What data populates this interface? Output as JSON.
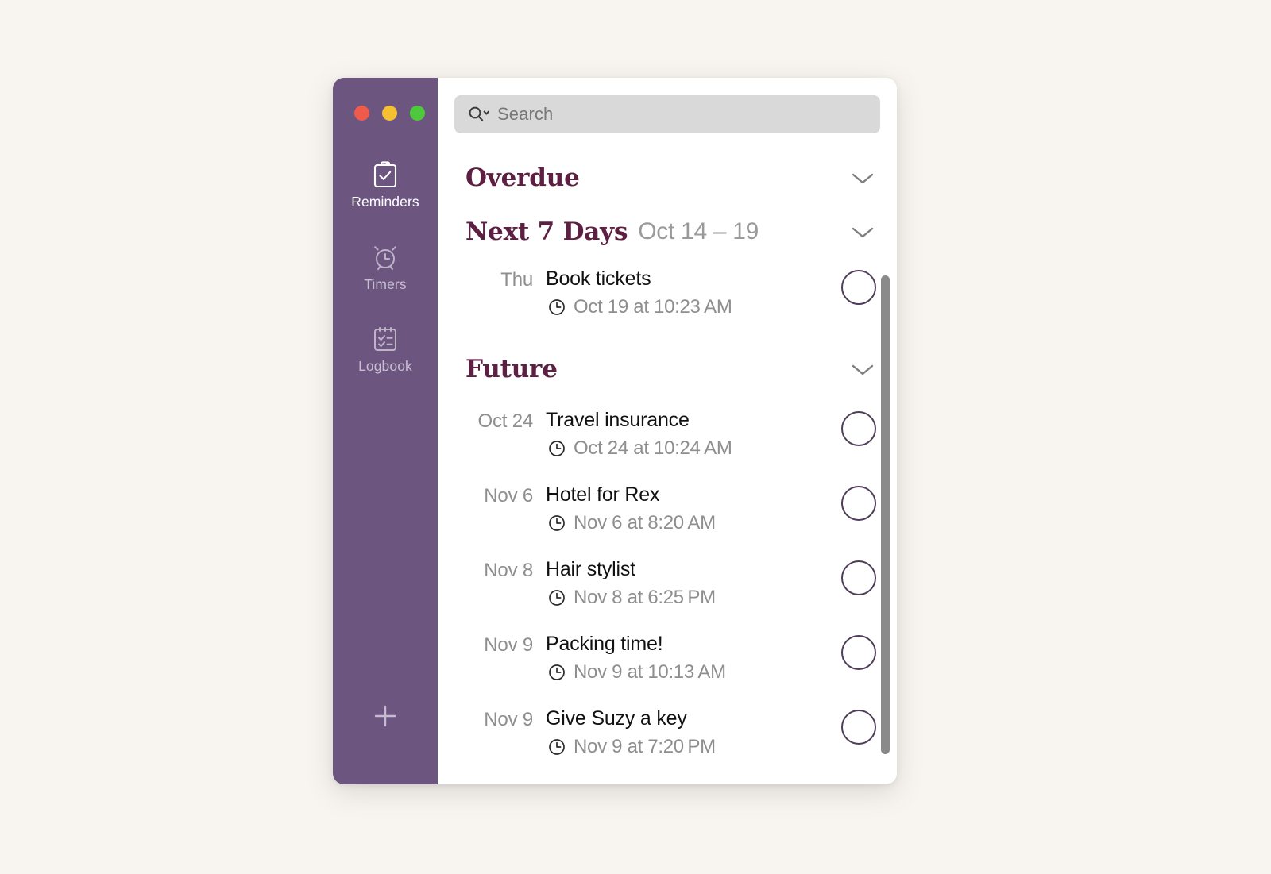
{
  "window": {
    "traffic_lights": [
      {
        "name": "close",
        "color": "#F05A4B"
      },
      {
        "name": "minimize",
        "color": "#F5C133"
      },
      {
        "name": "zoom",
        "color": "#4FC93C"
      }
    ]
  },
  "sidebar": {
    "background_color": "#6C5680",
    "items": [
      {
        "label": "Reminders",
        "icon": "clipboard-check-icon",
        "active": true
      },
      {
        "label": "Timers",
        "icon": "alarm-clock-icon",
        "active": false
      },
      {
        "label": "Logbook",
        "icon": "checklist-icon",
        "active": false
      }
    ],
    "add_button": {
      "icon": "plus-icon",
      "label": "+"
    }
  },
  "search": {
    "placeholder": "Search",
    "value": "",
    "icon": "search-magnifier-chevron-icon"
  },
  "sections": [
    {
      "title": "Overdue",
      "range": "",
      "collapse_icon": "chevron-down-icon",
      "tasks": []
    },
    {
      "title": "Next 7 Days",
      "range": "Oct 14 – 19",
      "collapse_icon": "chevron-down-icon",
      "tasks": [
        {
          "date": "Thu",
          "title": "Book tickets",
          "time": "Oct 19 at 10:23 AM",
          "time_icon": "clock-icon",
          "checked": false
        }
      ]
    },
    {
      "title": "Future",
      "range": "",
      "collapse_icon": "chevron-down-icon",
      "tasks": [
        {
          "date": "Oct 24",
          "title": "Travel insurance",
          "time": "Oct 24 at 10:24 AM",
          "time_icon": "clock-icon",
          "checked": false
        },
        {
          "date": "Nov 6",
          "title": "Hotel for Rex",
          "time": "Nov 6 at 8:20 AM",
          "time_icon": "clock-icon",
          "checked": false
        },
        {
          "date": "Nov 8",
          "title": "Hair stylist",
          "time": "Nov 8 at 6:25 PM",
          "time_icon": "clock-icon",
          "checked": false
        },
        {
          "date": "Nov 9",
          "title": "Packing time!",
          "time": "Nov 9 at 10:13 AM",
          "time_icon": "clock-icon",
          "checked": false
        },
        {
          "date": "Nov 9",
          "title": "Give Suzy a key",
          "time": "Nov 9 at 7:20 PM",
          "time_icon": "clock-icon",
          "checked": false
        }
      ]
    }
  ],
  "colors": {
    "page_background": "#F8F5F1",
    "sidebar": "#6C5680",
    "heading": "#5D1F42",
    "muted_text": "#8E8E8E",
    "search_field": "#D9D9D9",
    "checkbox_outline": "#4F3C59",
    "scrollbar": "#8A8A8A"
  }
}
